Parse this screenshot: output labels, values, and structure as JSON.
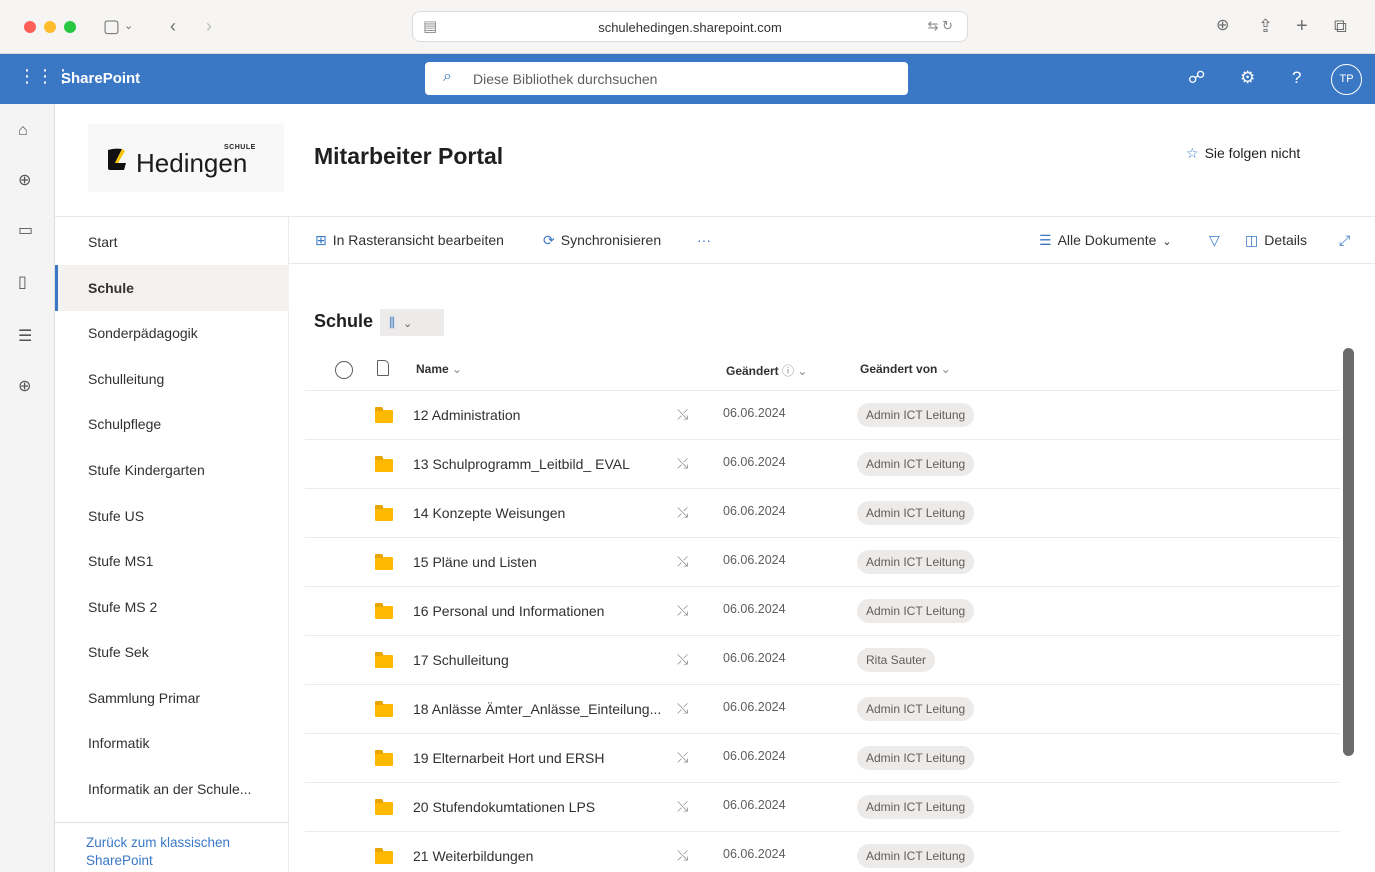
{
  "browser": {
    "url": "schulehedingen.sharepoint.com"
  },
  "suite": {
    "app_name": "SharePoint",
    "search_placeholder": "Diese Bibliothek durchsuchen",
    "avatar_initials": "TP"
  },
  "site": {
    "logo_small": "SCHULE",
    "logo_name": "Hedingen",
    "title": "Mitarbeiter Portal",
    "follow_label": "Sie folgen nicht"
  },
  "nav": {
    "items": [
      {
        "label": "Start"
      },
      {
        "label": "Schule"
      },
      {
        "label": "Sonderpädagogik"
      },
      {
        "label": "Schulleitung"
      },
      {
        "label": "Schulpflege"
      },
      {
        "label": "Stufe Kindergarten"
      },
      {
        "label": "Stufe US"
      },
      {
        "label": "Stufe MS1"
      },
      {
        "label": "Stufe MS 2"
      },
      {
        "label": "Stufe Sek"
      },
      {
        "label": "Sammlung Primar"
      },
      {
        "label": "Informatik"
      },
      {
        "label": "Informatik an der Schule..."
      }
    ],
    "back_link": "Zurück zum klassischen SharePoint"
  },
  "commands": {
    "grid_edit": "In Rasteransicht bearbeiten",
    "sync": "Synchronisieren",
    "more": "···",
    "view": "Alle Dokumente",
    "details": "Details"
  },
  "library": {
    "title": "Schule",
    "columns": {
      "name": "Name",
      "modified": "Geändert",
      "modified_by": "Geändert von"
    },
    "rows": [
      {
        "name": "12 Administration",
        "date": "06.06.2024",
        "by": "Admin ICT Leitung"
      },
      {
        "name": "13 Schulprogramm_Leitbild_ EVAL",
        "date": "06.06.2024",
        "by": "Admin ICT Leitung"
      },
      {
        "name": "14 Konzepte Weisungen",
        "date": "06.06.2024",
        "by": "Admin ICT Leitung"
      },
      {
        "name": "15 Pläne und Listen",
        "date": "06.06.2024",
        "by": "Admin ICT Leitung"
      },
      {
        "name": "16 Personal und Informationen",
        "date": "06.06.2024",
        "by": "Admin ICT Leitung"
      },
      {
        "name": "17 Schulleitung",
        "date": "06.06.2024",
        "by": "Rita Sauter"
      },
      {
        "name": "18 Anlässe Ämter_Anlässe_Einteilung...",
        "date": "06.06.2024",
        "by": "Admin ICT Leitung"
      },
      {
        "name": "19 Elternarbeit Hort und ERSH",
        "date": "06.06.2024",
        "by": "Admin ICT Leitung"
      },
      {
        "name": "20 Stufendokumtationen LPS",
        "date": "06.06.2024",
        "by": "Admin ICT Leitung"
      },
      {
        "name": "21 Weiterbildungen",
        "date": "06.06.2024",
        "by": "Admin ICT Leitung"
      }
    ]
  },
  "colors": {
    "brand_blue": "#3a78c6",
    "folder_yellow": "#ffb900",
    "logo_yellow": "#f5c400"
  }
}
